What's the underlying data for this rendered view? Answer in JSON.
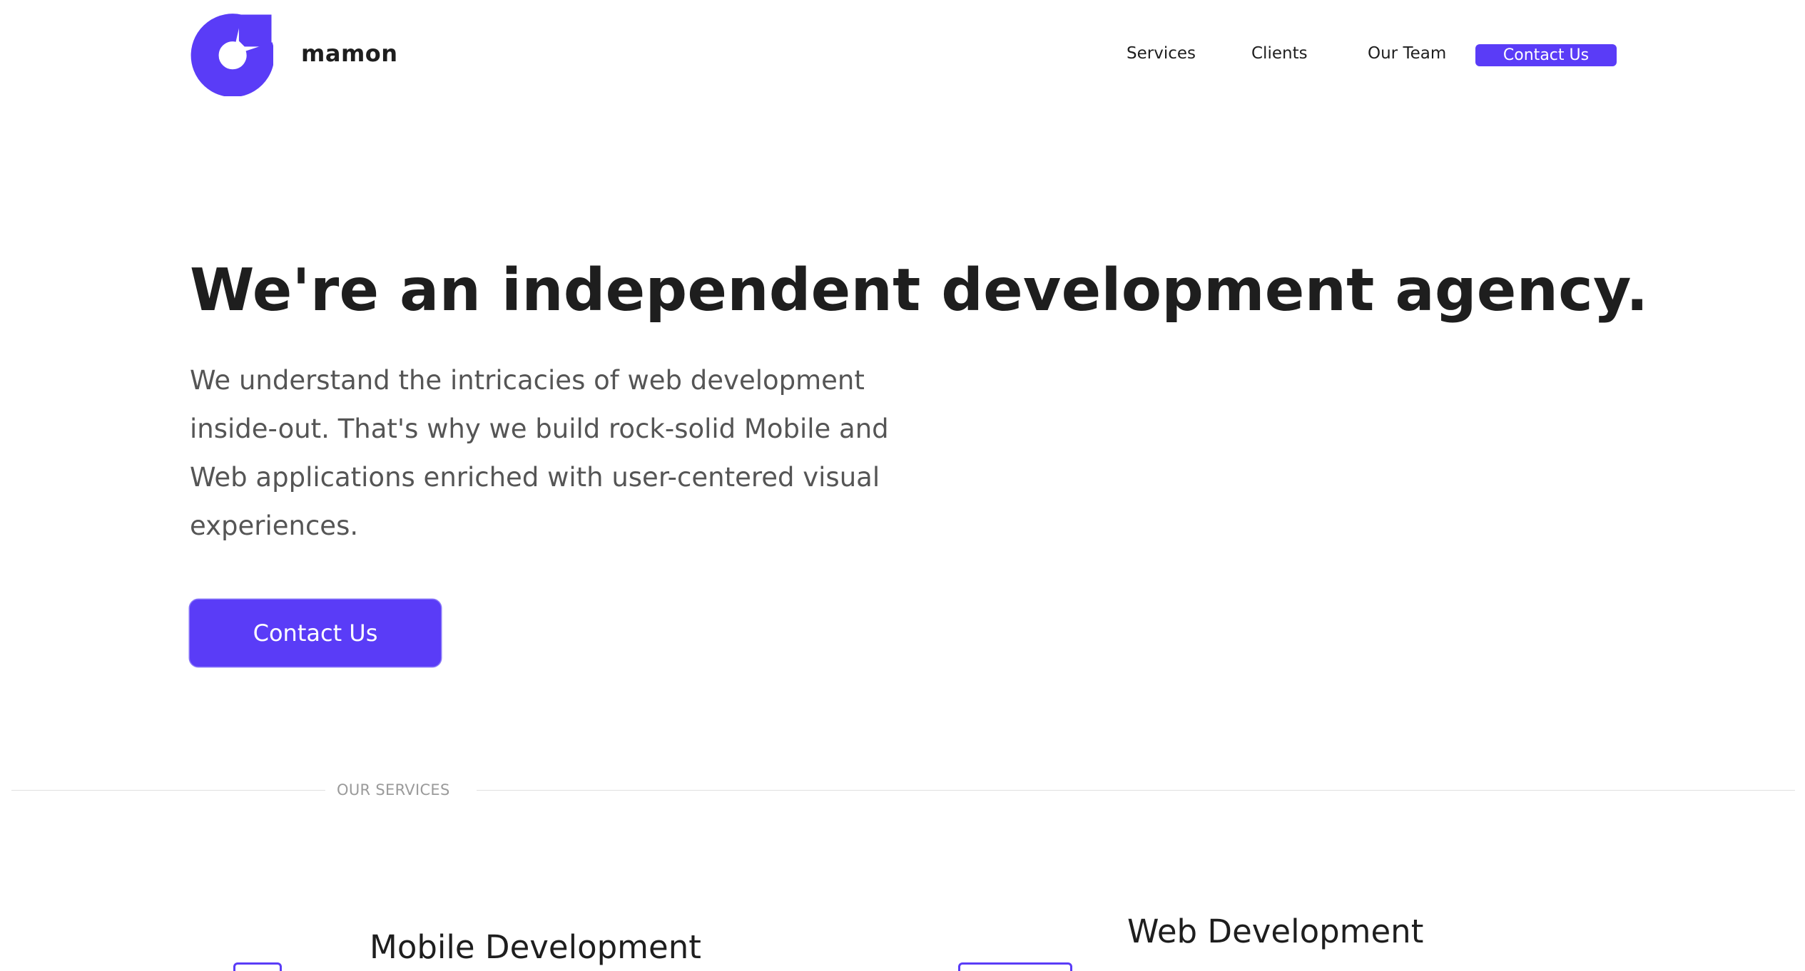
{
  "header": {
    "brand": "mamon",
    "nav": [
      "Services",
      "Clients",
      "Our Team"
    ],
    "cta_label": "Contact Us"
  },
  "hero": {
    "title": "We're an independent development agency.",
    "description": "We understand the intricacies of web development inside-out. That's why we build rock-solid Mobile and Web applications enriched with user-centered visual experiences.",
    "cta_label": "Contact Us"
  },
  "services": {
    "section_label": "OUR SERVICES",
    "items": [
      {
        "title": "Mobile Development",
        "icon": "mobile-icon"
      },
      {
        "title": "Web Development",
        "icon": "browser-icon"
      }
    ]
  },
  "colors": {
    "accent": "#5a3cf7",
    "text": "#1e1e1e",
    "muted_text": "#555555",
    "divider": "#e0e0e0",
    "section_label": "#9a9a9a"
  }
}
